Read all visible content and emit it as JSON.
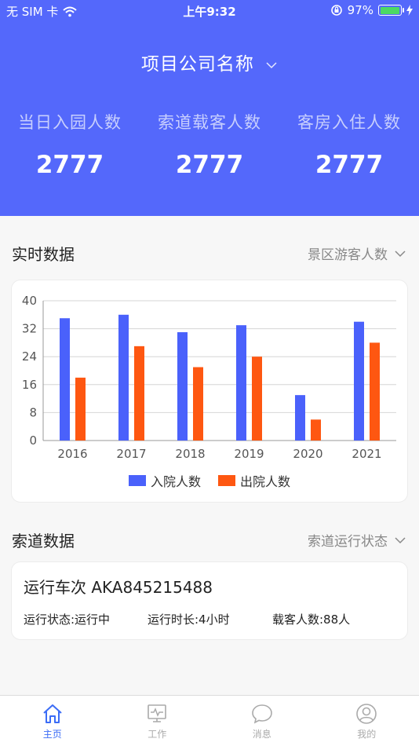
{
  "status_bar": {
    "carrier": "无 SIM 卡",
    "time": "上午9:32",
    "battery": "97%",
    "battery_level": 0.97
  },
  "header": {
    "company_name": "项目公司名称",
    "stats": [
      {
        "label": "当日入园人数",
        "value": "2777"
      },
      {
        "label": "索道载客人数",
        "value": "2777"
      },
      {
        "label": "客房入住人数",
        "value": "2777"
      }
    ]
  },
  "realtime": {
    "title": "实时数据",
    "selector": "景区游客人数"
  },
  "chart_data": {
    "type": "bar",
    "categories": [
      "2016",
      "2017",
      "2018",
      "2019",
      "2020",
      "2021"
    ],
    "series": [
      {
        "name": "入院人数",
        "values": [
          35,
          36,
          31,
          33,
          13,
          34
        ],
        "color": "#4a61fb"
      },
      {
        "name": "出院人数",
        "values": [
          18,
          27,
          21,
          24,
          6,
          28
        ],
        "color": "#fe5711"
      }
    ],
    "ylim": [
      0,
      40
    ],
    "yticks": [
      "0",
      "8",
      "16",
      "24",
      "32",
      "40"
    ],
    "grid": true,
    "legend_position": "bottom"
  },
  "ropeway": {
    "title": "索道数据",
    "selector": "索道运行状态",
    "card_title": "运行车次 AKA845215488",
    "status": "运行状态:运行中",
    "duration": "运行时长:4小时",
    "passengers": "载客人数:88人"
  },
  "tabbar": [
    {
      "label": "主页",
      "icon": "home-icon",
      "active": true
    },
    {
      "label": "工作",
      "icon": "monitor-icon",
      "active": false
    },
    {
      "label": "消息",
      "icon": "message-icon",
      "active": false
    },
    {
      "label": "我的",
      "icon": "user-icon",
      "active": false
    }
  ]
}
